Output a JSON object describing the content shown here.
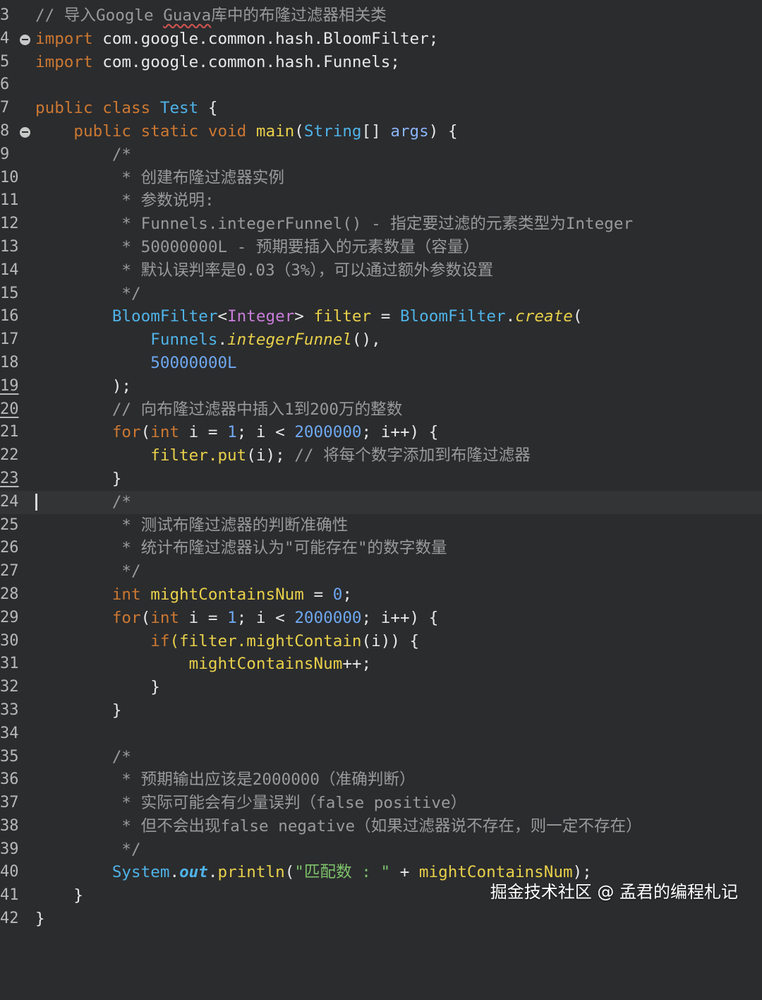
{
  "editor": {
    "gutter_lines": [
      "3",
      "4",
      "5",
      "6",
      "7",
      "8",
      "9",
      "10",
      "11",
      "12",
      "13",
      "14",
      "15",
      "16",
      "17",
      "18",
      "19",
      "20",
      "21",
      "22",
      "23",
      "24",
      "25",
      "26",
      "27",
      "28",
      "29",
      "30",
      "31",
      "32",
      "33",
      "34",
      "35",
      "36",
      "37",
      "38",
      "39",
      "40",
      "41",
      "42"
    ],
    "l3": {
      "cm_a": "// 导入Google ",
      "cm_b": "Guava",
      "cm_c": "库中的布隆过滤器相关类"
    },
    "l4": {
      "kw": "import",
      "rest": " com.google.common.hash.BloomFilter;"
    },
    "l5": {
      "kw": "import",
      "rest": " com.google.common.hash.Funnels;"
    },
    "l7": {
      "kw": "public class ",
      "ty": "Test",
      "rest": " {"
    },
    "l8": {
      "kw": "public static void ",
      "fn": "main",
      "p1": "(",
      "ty": "String",
      "p2": "[] ",
      "pm": "args",
      "p3": ") {"
    },
    "l9": "/*",
    "l10": " * 创建布隆过滤器实例",
    "l11": " * 参数说明:",
    "l12": " * Funnels.integerFunnel() - 指定要过滤的元素类型为Integer",
    "l13": " * 50000000L - 预期要插入的元素数量（容量）",
    "l14": " * 默认误判率是0.03（3%），可以通过额外参数设置",
    "l15": " */",
    "l16": {
      "ty1": "BloomFilter",
      "lt": "<",
      "ty2": "Integer",
      "gt": "> ",
      "vr": "filter",
      "eq": " = ",
      "ty3": "BloomFilter",
      "dot": ".",
      "fn": "create",
      "paren": "("
    },
    "l17": {
      "ty": "Funnels",
      "dot": ".",
      "fn": "integerFunnel",
      "rest": "(),"
    },
    "l18": "50000000L",
    "l19": ");",
    "l20": "// 向布隆过滤器中插入1到200万的整数",
    "l21": {
      "kw1": "for",
      "p1": "(",
      "kw2": "int",
      "a": " i = ",
      "n1": "1",
      "b": "; i < ",
      "n2": "2000000",
      "c": "; i++) {"
    },
    "l22": {
      "a": "filter.",
      "fn": "put",
      "b": "(i); ",
      "cm": "// 将每个数字添加到布隆过滤器"
    },
    "l23": "}",
    "l24": "/*",
    "l25": " * 测试布隆过滤器的判断准确性",
    "l26": " * 统计布隆过滤器认为\"可能存在\"的数字数量",
    "l27": " */",
    "l28": {
      "kw": "int ",
      "vr": "mightContainsNum",
      "a": " = ",
      "n": "0",
      "b": ";"
    },
    "l29": {
      "kw1": "for",
      "p1": "(",
      "kw2": "int",
      "a": " i = ",
      "n1": "1",
      "b": "; i < ",
      "n2": "2000000",
      "c": "; i++) {"
    },
    "l30": {
      "kw": "if",
      "a": "(filter.",
      "fn": "mightContain",
      "b": "(i)) {"
    },
    "l31": {
      "vr": "mightContainsNum",
      "a": "++;"
    },
    "l32": "}",
    "l33": "}",
    "l35": "/*",
    "l36": " * 预期输出应该是2000000（准确判断）",
    "l37": " * 实际可能会有少量误判（false positive）",
    "l38": " * 但不会出现false negative（如果过滤器说不存在，则一定不存在）",
    "l39": " */",
    "l40": {
      "ty": "System",
      "dot": ".",
      "out": "out",
      "dot2": ".",
      "fn": "println",
      "p1": "(",
      "str": "\"匹配数 : \"",
      "a": " + ",
      "vr": "mightContainsNum",
      "b": ");"
    },
    "l41": "}",
    "l42": "}"
  },
  "watermark": "掘金技术社区 @ 孟君的编程札记"
}
